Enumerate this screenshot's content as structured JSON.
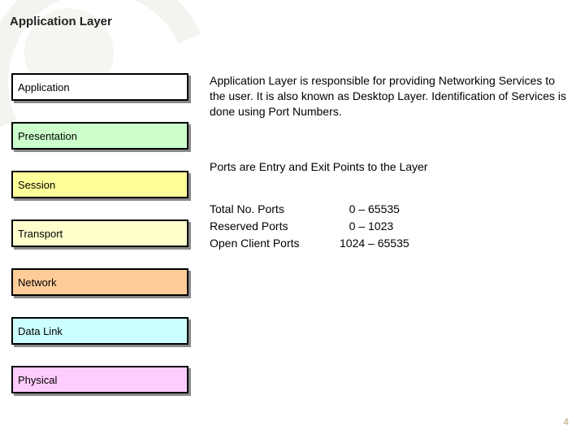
{
  "slide": {
    "title": "Application Layer",
    "page_number": "4"
  },
  "layers": [
    {
      "name": "Application",
      "colorClass": "c-application"
    },
    {
      "name": "Presentation",
      "colorClass": "c-presentation"
    },
    {
      "name": "Session",
      "colorClass": "c-session"
    },
    {
      "name": "Transport",
      "colorClass": "c-transport"
    },
    {
      "name": "Network",
      "colorClass": "c-network"
    },
    {
      "name": "Data Link",
      "colorClass": "c-datalink"
    },
    {
      "name": "Physical",
      "colorClass": "c-physical"
    }
  ],
  "content": {
    "description": "Application  Layer  is responsible for  providing Networking Services  to the user.    It is also known as Desktop Layer. Identification of Services is done using Port Numbers.",
    "session_note": "Ports are Entry and Exit Points to the Layer",
    "ports": [
      {
        "label": "Total No. Ports",
        "range": "0 – 65535"
      },
      {
        "label": "Reserved Ports",
        "range": "0 – 1023"
      },
      {
        "label": "Open Client Ports",
        "range": "1024 – 65535"
      }
    ]
  }
}
